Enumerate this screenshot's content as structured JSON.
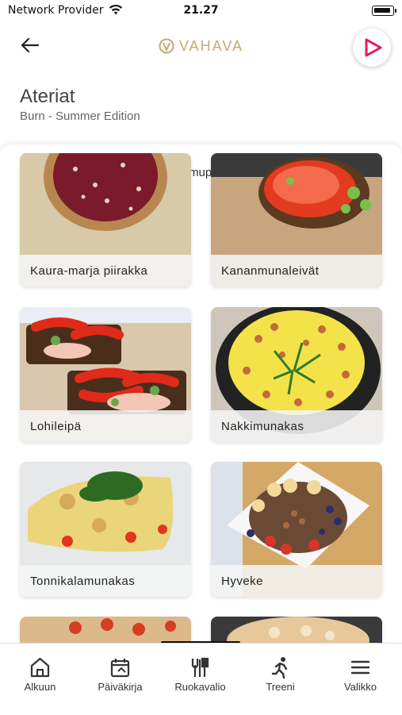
{
  "status_bar": {
    "carrier": "Network Provider",
    "time": "21.27"
  },
  "header": {
    "logo_text": "VAHAVA"
  },
  "page": {
    "title": "Ateriat",
    "subtitle": "Burn - Summer Edition"
  },
  "meal_nav": {
    "label": "Aamupala"
  },
  "meals": [
    {
      "name": "Kaura-marja piirakka"
    },
    {
      "name": "Kananmunaleivät"
    },
    {
      "name": "Lohileipä"
    },
    {
      "name": "Nakkimunakas"
    },
    {
      "name": "Tonnikalamunakas"
    },
    {
      "name": "Hyveke"
    }
  ],
  "tabs": [
    {
      "label": "Alkuun",
      "icon": "home-icon"
    },
    {
      "label": "Päiväkirja",
      "icon": "calendar-icon"
    },
    {
      "label": "Ruokavalio",
      "icon": "cutlery-icon"
    },
    {
      "label": "Treeni",
      "icon": "running-icon"
    },
    {
      "label": "Valikko",
      "icon": "menu-icon"
    }
  ],
  "colors": {
    "brand_gold": "#c9a774",
    "play_accent": "#e8175d"
  }
}
